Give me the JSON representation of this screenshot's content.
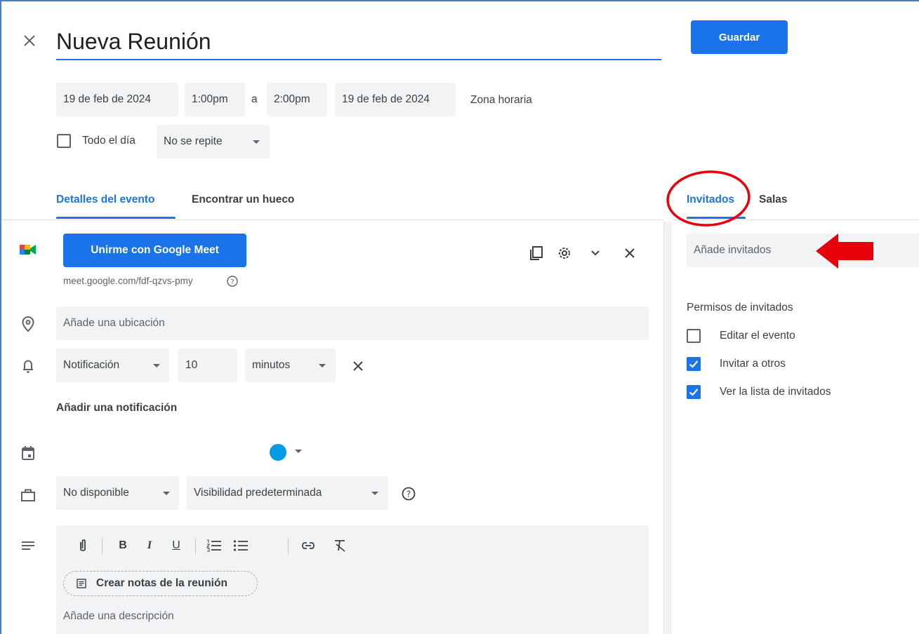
{
  "header": {
    "title": "Nueva Reunión",
    "save_label": "Guardar"
  },
  "datetime": {
    "start_date": "19 de feb de 2024",
    "start_time": "1:00pm",
    "separator": "a",
    "end_time": "2:00pm",
    "end_date": "19 de feb de 2024",
    "timezone": "Zona horaria",
    "all_day": "Todo el día",
    "repeat": "No se repite"
  },
  "tabs": {
    "details": "Detalles del evento",
    "find_slot": "Encontrar un hueco",
    "guests": "Invitados",
    "rooms": "Salas"
  },
  "meet": {
    "join_label": "Unirme con Google Meet",
    "link": "meet.google.com/fdf-qzvs-pmy"
  },
  "location": {
    "placeholder": "Añade una ubicación"
  },
  "notification": {
    "type": "Notificación",
    "amount": "10",
    "unit": "minutos",
    "add_label": "Añadir una notificación"
  },
  "calendar": {
    "color": "#039be5"
  },
  "availability": {
    "status": "No disponible",
    "visibility": "Visibilidad predeterminada"
  },
  "description": {
    "notes_label": "Crear notas de la reunión",
    "placeholder": "Añade una descripción"
  },
  "guests": {
    "placeholder": "Añade invitados",
    "permissions_title": "Permisos de invitados",
    "permissions": [
      {
        "label": "Editar el evento",
        "checked": false
      },
      {
        "label": "Invitar a otros",
        "checked": true
      },
      {
        "label": "Ver la lista de invitados",
        "checked": true
      }
    ]
  },
  "colors": {
    "accent": "#1a73e8",
    "annotation": "#e8000b"
  }
}
